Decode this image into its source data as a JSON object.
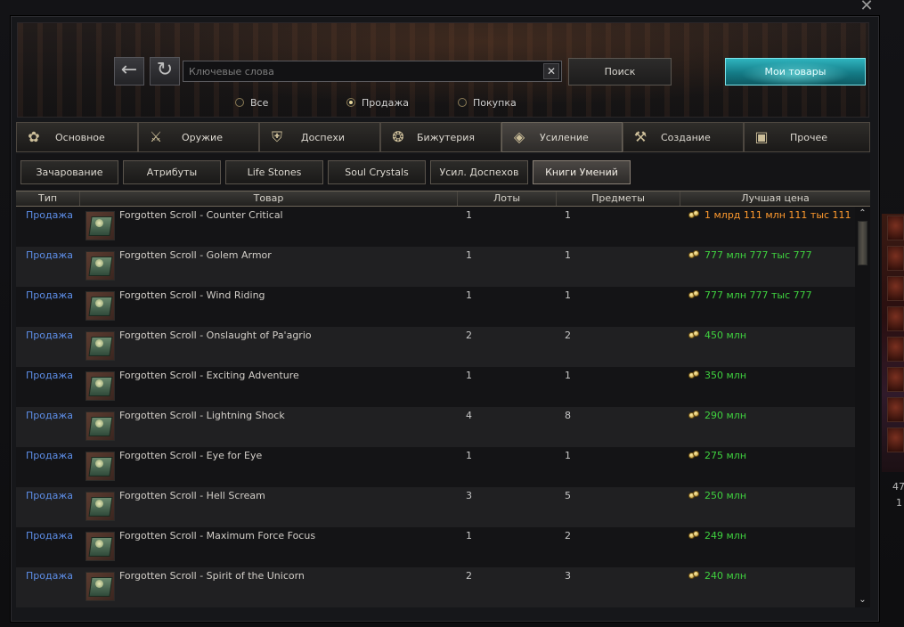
{
  "window": {
    "close_label": "✕"
  },
  "nav": {
    "back_icon": "←",
    "refresh_icon": "↻"
  },
  "search": {
    "placeholder": "Ключевые слова",
    "value": "",
    "clear_icon": "✕",
    "search_button": "Поиск",
    "my_goods_button": "Мои товары"
  },
  "filter": {
    "options": [
      {
        "label": "Все",
        "selected": false
      },
      {
        "label": "Продажа",
        "selected": true
      },
      {
        "label": "Покупка",
        "selected": false
      }
    ]
  },
  "categories": [
    {
      "label": "Основное",
      "icon": "basic-icon",
      "active": false
    },
    {
      "label": "Оружие",
      "icon": "weapon-icon",
      "active": false
    },
    {
      "label": "Доспехи",
      "icon": "armor-icon",
      "active": false
    },
    {
      "label": "Бижутерия",
      "icon": "jewelry-icon",
      "active": false
    },
    {
      "label": "Усиление",
      "icon": "enhance-icon",
      "active": true
    },
    {
      "label": "Создание",
      "icon": "craft-icon",
      "active": false
    },
    {
      "label": "Прочее",
      "icon": "misc-icon",
      "active": false
    }
  ],
  "subcategories": [
    {
      "label": "Зачарование",
      "active": false
    },
    {
      "label": "Атрибуты",
      "active": false
    },
    {
      "label": "Life Stones",
      "active": false
    },
    {
      "label": "Soul Crystals",
      "active": false
    },
    {
      "label": "Усил. Доспехов",
      "active": false
    },
    {
      "label": "Книги Умений",
      "active": true
    }
  ],
  "table": {
    "columns": [
      "Тип",
      "Товар",
      "Лоты",
      "Предметы",
      "Лучшая цена"
    ],
    "rows": [
      {
        "type": "Продажа",
        "name": "Forgotten Scroll - Counter Critical",
        "lots": "1",
        "items": "1",
        "price": "1 млрд 111 млн 111 тыс 111",
        "price_color": "#ff9a2e"
      },
      {
        "type": "Продажа",
        "name": "Forgotten Scroll - Golem Armor",
        "lots": "1",
        "items": "1",
        "price": "777 млн 777 тыс 777",
        "price_color": "#3fd13f"
      },
      {
        "type": "Продажа",
        "name": "Forgotten Scroll - Wind Riding",
        "lots": "1",
        "items": "1",
        "price": "777 млн 777 тыс 777",
        "price_color": "#3fd13f"
      },
      {
        "type": "Продажа",
        "name": "Forgotten Scroll - Onslaught of Pa'agrio",
        "lots": "2",
        "items": "2",
        "price": "450 млн",
        "price_color": "#3fd13f"
      },
      {
        "type": "Продажа",
        "name": "Forgotten Scroll - Exciting Adventure",
        "lots": "1",
        "items": "1",
        "price": "350 млн",
        "price_color": "#3fd13f"
      },
      {
        "type": "Продажа",
        "name": "Forgotten Scroll - Lightning Shock",
        "lots": "4",
        "items": "8",
        "price": "290 млн",
        "price_color": "#3fd13f"
      },
      {
        "type": "Продажа",
        "name": "Forgotten Scroll - Eye for Eye",
        "lots": "1",
        "items": "1",
        "price": "275 млн",
        "price_color": "#3fd13f"
      },
      {
        "type": "Продажа",
        "name": "Forgotten Scroll - Hell Scream",
        "lots": "3",
        "items": "5",
        "price": "250 млн",
        "price_color": "#3fd13f"
      },
      {
        "type": "Продажа",
        "name": "Forgotten Scroll - Maximum Force Focus",
        "lots": "1",
        "items": "2",
        "price": "249 млн",
        "price_color": "#3fd13f"
      },
      {
        "type": "Продажа",
        "name": "Forgotten Scroll - Spirit of the Unicorn",
        "lots": "2",
        "items": "3",
        "price": "240 млн",
        "price_color": "#3fd13f"
      }
    ]
  },
  "side_strip": {
    "texts": [
      "47",
      "1"
    ]
  }
}
